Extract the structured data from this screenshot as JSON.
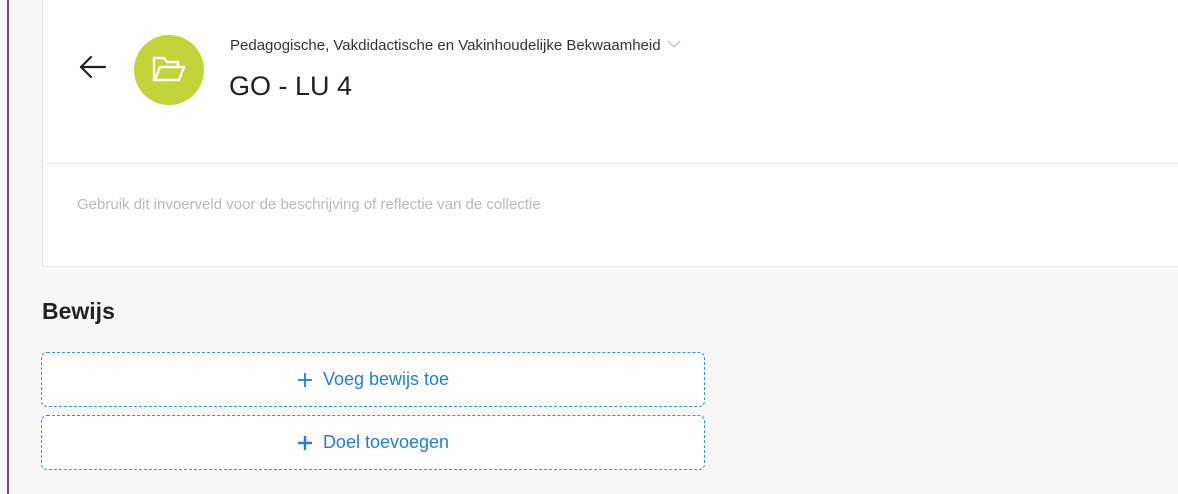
{
  "header": {
    "breadcrumb": "Pedagogische, Vakdidactische en Vakinhoudelijke Bekwaamheid",
    "title": "GO - LU 4",
    "icons": {
      "back": "arrow-left-icon",
      "collection": "folder-open-icon",
      "breadcrumb_toggle": "chevron-down-icon"
    },
    "accent_color": "#c3d33a"
  },
  "description": {
    "placeholder": "Gebruik dit invoerveld voor de beschrijving of reflectie van de collectie"
  },
  "evidence": {
    "heading": "Bewijs",
    "add_evidence_label": "Voeg bewijs toe",
    "add_goal_label": "Doel toevoegen",
    "button_color": "#1f7fe0"
  }
}
